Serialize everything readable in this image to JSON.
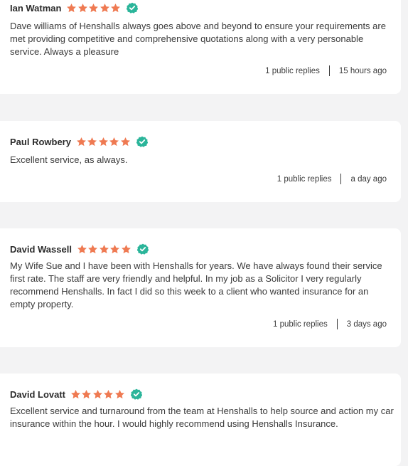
{
  "theme": {
    "star_color": "#ef7a52",
    "verified_color": "#2bb59a",
    "background": "#f3f3f4",
    "card": "#ffffff"
  },
  "icons": {
    "rating": "star-icon",
    "verified": "verified-check-icon"
  },
  "reviews": [
    {
      "name": "Ian Watman",
      "rating": 5,
      "verified": true,
      "text": "Dave williams of Henshalls always goes above and beyond to  ensure your requirements are met providing competitive and comprehensive quotations along with a very personable service. Always a pleasure",
      "replies": "1 public replies",
      "time": "15 hours ago"
    },
    {
      "name": "Paul Rowbery",
      "rating": 5,
      "verified": true,
      "text": "Excellent service, as always.",
      "replies": "1 public replies",
      "time": "a day ago"
    },
    {
      "name": "David Wassell",
      "rating": 5,
      "verified": true,
      "text": "My Wife Sue and I have been with Henshalls for years. We have always found their service first rate. The staff are very friendly and helpful. In my job as a Solicitor I very regularly recommend Henshalls. In fact I did so this week to a client who wanted insurance for an empty property.",
      "replies": "1 public replies",
      "time": "3 days ago"
    },
    {
      "name": "David Lovatt",
      "rating": 5,
      "verified": true,
      "text": "Excellent service and turnaround from the team at Henshalls to help source and action my car insurance within the hour. I would highly recommend using Henshalls Insurance.",
      "replies": "",
      "time": ""
    }
  ]
}
